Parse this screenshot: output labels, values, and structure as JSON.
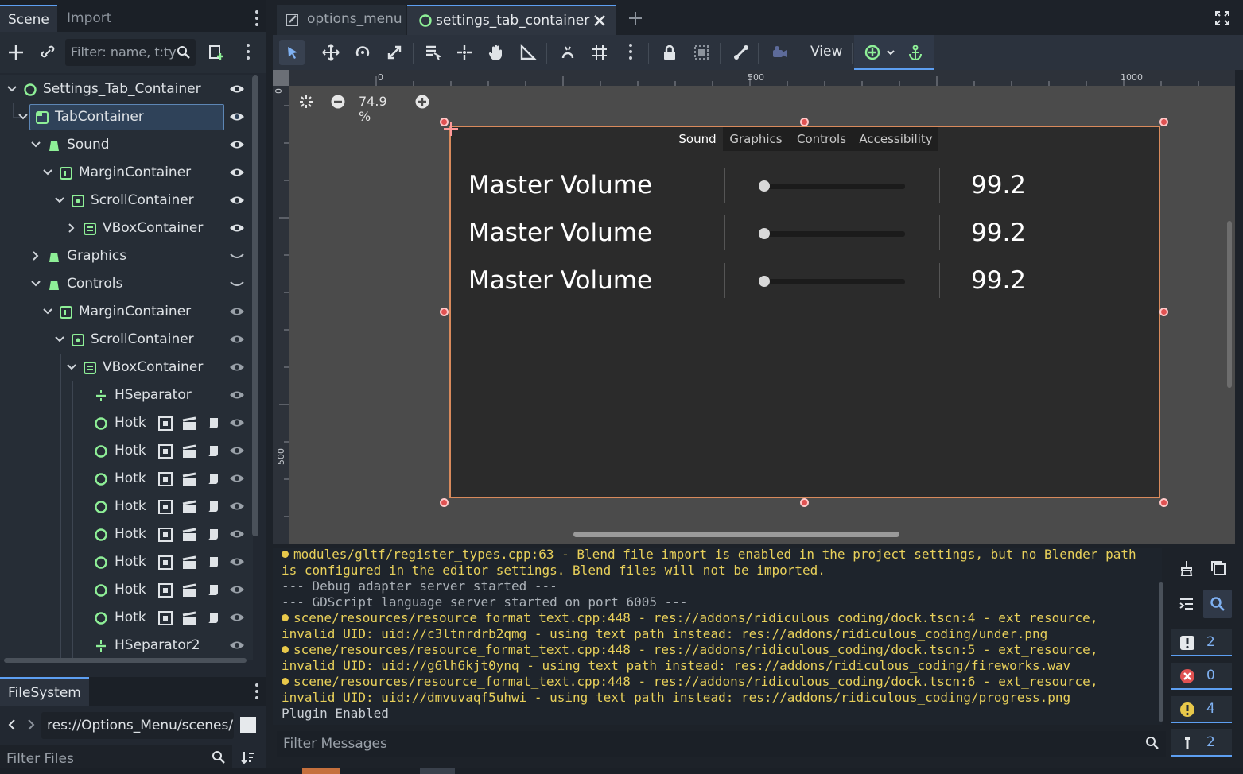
{
  "left_dock": {
    "tabs": [
      "Scene",
      "Import"
    ],
    "filter_placeholder": "Filter: name, t:ty",
    "tree": [
      {
        "label": "Settings_Tab_Container",
        "icon": "control-node-icon"
      },
      {
        "label": "TabContainer",
        "icon": "tab-container-icon",
        "selected": true
      },
      {
        "label": "Sound",
        "icon": "tab-page-icon"
      },
      {
        "label": "MarginContainer",
        "icon": "margin-container-icon"
      },
      {
        "label": "ScrollContainer",
        "icon": "scroll-container-icon"
      },
      {
        "label": "VBoxContainer",
        "icon": "vbox-container-icon"
      },
      {
        "label": "Graphics",
        "icon": "tab-page-icon"
      },
      {
        "label": "Controls",
        "icon": "tab-page-icon"
      },
      {
        "label": "MarginContainer",
        "icon": "margin-container-icon"
      },
      {
        "label": "ScrollContainer",
        "icon": "scroll-container-icon"
      },
      {
        "label": "VBoxContainer",
        "icon": "vbox-container-icon"
      },
      {
        "label": "HSeparator",
        "icon": "hseparator-icon"
      },
      {
        "label": "Hotk",
        "icon": "control-node-icon"
      },
      {
        "label": "Hotk",
        "icon": "control-node-icon"
      },
      {
        "label": "Hotk",
        "icon": "control-node-icon"
      },
      {
        "label": "Hotk",
        "icon": "control-node-icon"
      },
      {
        "label": "Hotk",
        "icon": "control-node-icon"
      },
      {
        "label": "Hotk",
        "icon": "control-node-icon"
      },
      {
        "label": "Hotk",
        "icon": "control-node-icon"
      },
      {
        "label": "Hotk",
        "icon": "control-node-icon"
      },
      {
        "label": "HSeparator2",
        "icon": "hseparator-icon"
      }
    ],
    "filesystem": {
      "tab": "FileSystem",
      "path": "res://Options_Menu/scenes/",
      "filter_placeholder": "Filter Files"
    }
  },
  "editor": {
    "scene_tabs": [
      {
        "label": "options_menu",
        "active": false
      },
      {
        "label": "settings_tab_container",
        "active": true
      }
    ],
    "toolbar": {
      "view_label": "View"
    },
    "zoom": "74.9 %",
    "ruler_labels": [
      "0",
      "500",
      "1000"
    ],
    "ruler_left_labels": [
      "0",
      "500"
    ],
    "game_tabs": [
      "Sound",
      "Graphics",
      "Controls",
      "Accessibility"
    ],
    "volume_rows": [
      {
        "label": "Master Volume",
        "value": "99.2",
        "slider_fraction": 0.02
      },
      {
        "label": "Master Volume",
        "value": "99.2",
        "slider_fraction": 0.02
      },
      {
        "label": "Master Volume",
        "value": "99.2",
        "slider_fraction": 0.02
      }
    ]
  },
  "output": {
    "lines": [
      {
        "text": "modules/gltf/register_types.cpp:63 - Blend file import is enabled in the project settings, but no Blender path",
        "kind": "warn",
        "dot": true
      },
      {
        "text": "is configured in the editor settings. Blend files will not be imported.",
        "kind": "warn",
        "dot": false
      },
      {
        "text": "--- Debug adapter server started ---",
        "kind": "dim",
        "dot": false
      },
      {
        "text": "--- GDScript language server started on port 6005 ---",
        "kind": "dim",
        "dot": false
      },
      {
        "text": "scene/resources/resource_format_text.cpp:448 - res://addons/ridiculous_coding/dock.tscn:4 - ext_resource,",
        "kind": "warn",
        "dot": true
      },
      {
        "text": "invalid UID: uid://c3ltnrdrb2qmg - using text path instead: res://addons/ridiculous_coding/under.png",
        "kind": "warn",
        "dot": false
      },
      {
        "text": "scene/resources/resource_format_text.cpp:448 - res://addons/ridiculous_coding/dock.tscn:5 - ext_resource,",
        "kind": "warn",
        "dot": true
      },
      {
        "text": "invalid UID: uid://g6lh6kjt0ynq - using text path instead: res://addons/ridiculous_coding/fireworks.wav",
        "kind": "warn",
        "dot": false
      },
      {
        "text": "scene/resources/resource_format_text.cpp:448 - res://addons/ridiculous_coding/dock.tscn:6 - ext_resource,",
        "kind": "warn",
        "dot": true
      },
      {
        "text": "invalid UID: uid://dmvuvaqf5uhwi - using text path instead: res://addons/ridiculous_coding/progress.png",
        "kind": "warn",
        "dot": false
      },
      {
        "text": "Plugin Enabled",
        "kind": "plain",
        "dot": false
      }
    ],
    "filter_placeholder": "Filter Messages",
    "counts": {
      "messages": "2",
      "errors": "0",
      "warnings": "4",
      "editor": "2"
    }
  },
  "colors": {
    "accent": "#5d9ff2",
    "node_green": "#8eef97",
    "selection_border": "#d98a5c",
    "handle_red": "#e05252",
    "warning_yellow": "#e8d05a"
  }
}
